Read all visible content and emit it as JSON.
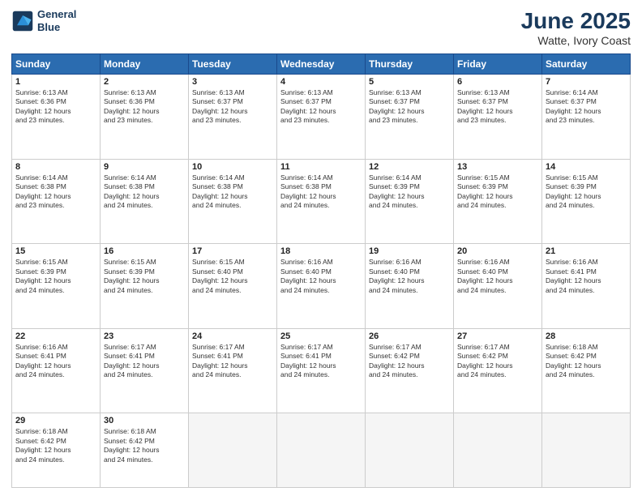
{
  "logo": {
    "line1": "General",
    "line2": "Blue"
  },
  "title": "June 2025",
  "subtitle": "Watte, Ivory Coast",
  "days_of_week": [
    "Sunday",
    "Monday",
    "Tuesday",
    "Wednesday",
    "Thursday",
    "Friday",
    "Saturday"
  ],
  "weeks": [
    [
      {
        "day": "1",
        "info": "Sunrise: 6:13 AM\nSunset: 6:36 PM\nDaylight: 12 hours\nand 23 minutes."
      },
      {
        "day": "2",
        "info": "Sunrise: 6:13 AM\nSunset: 6:36 PM\nDaylight: 12 hours\nand 23 minutes."
      },
      {
        "day": "3",
        "info": "Sunrise: 6:13 AM\nSunset: 6:37 PM\nDaylight: 12 hours\nand 23 minutes."
      },
      {
        "day": "4",
        "info": "Sunrise: 6:13 AM\nSunset: 6:37 PM\nDaylight: 12 hours\nand 23 minutes."
      },
      {
        "day": "5",
        "info": "Sunrise: 6:13 AM\nSunset: 6:37 PM\nDaylight: 12 hours\nand 23 minutes."
      },
      {
        "day": "6",
        "info": "Sunrise: 6:13 AM\nSunset: 6:37 PM\nDaylight: 12 hours\nand 23 minutes."
      },
      {
        "day": "7",
        "info": "Sunrise: 6:14 AM\nSunset: 6:37 PM\nDaylight: 12 hours\nand 23 minutes."
      }
    ],
    [
      {
        "day": "8",
        "info": "Sunrise: 6:14 AM\nSunset: 6:38 PM\nDaylight: 12 hours\nand 23 minutes."
      },
      {
        "day": "9",
        "info": "Sunrise: 6:14 AM\nSunset: 6:38 PM\nDaylight: 12 hours\nand 24 minutes."
      },
      {
        "day": "10",
        "info": "Sunrise: 6:14 AM\nSunset: 6:38 PM\nDaylight: 12 hours\nand 24 minutes."
      },
      {
        "day": "11",
        "info": "Sunrise: 6:14 AM\nSunset: 6:38 PM\nDaylight: 12 hours\nand 24 minutes."
      },
      {
        "day": "12",
        "info": "Sunrise: 6:14 AM\nSunset: 6:39 PM\nDaylight: 12 hours\nand 24 minutes."
      },
      {
        "day": "13",
        "info": "Sunrise: 6:15 AM\nSunset: 6:39 PM\nDaylight: 12 hours\nand 24 minutes."
      },
      {
        "day": "14",
        "info": "Sunrise: 6:15 AM\nSunset: 6:39 PM\nDaylight: 12 hours\nand 24 minutes."
      }
    ],
    [
      {
        "day": "15",
        "info": "Sunrise: 6:15 AM\nSunset: 6:39 PM\nDaylight: 12 hours\nand 24 minutes."
      },
      {
        "day": "16",
        "info": "Sunrise: 6:15 AM\nSunset: 6:39 PM\nDaylight: 12 hours\nand 24 minutes."
      },
      {
        "day": "17",
        "info": "Sunrise: 6:15 AM\nSunset: 6:40 PM\nDaylight: 12 hours\nand 24 minutes."
      },
      {
        "day": "18",
        "info": "Sunrise: 6:16 AM\nSunset: 6:40 PM\nDaylight: 12 hours\nand 24 minutes."
      },
      {
        "day": "19",
        "info": "Sunrise: 6:16 AM\nSunset: 6:40 PM\nDaylight: 12 hours\nand 24 minutes."
      },
      {
        "day": "20",
        "info": "Sunrise: 6:16 AM\nSunset: 6:40 PM\nDaylight: 12 hours\nand 24 minutes."
      },
      {
        "day": "21",
        "info": "Sunrise: 6:16 AM\nSunset: 6:41 PM\nDaylight: 12 hours\nand 24 minutes."
      }
    ],
    [
      {
        "day": "22",
        "info": "Sunrise: 6:16 AM\nSunset: 6:41 PM\nDaylight: 12 hours\nand 24 minutes."
      },
      {
        "day": "23",
        "info": "Sunrise: 6:17 AM\nSunset: 6:41 PM\nDaylight: 12 hours\nand 24 minutes."
      },
      {
        "day": "24",
        "info": "Sunrise: 6:17 AM\nSunset: 6:41 PM\nDaylight: 12 hours\nand 24 minutes."
      },
      {
        "day": "25",
        "info": "Sunrise: 6:17 AM\nSunset: 6:41 PM\nDaylight: 12 hours\nand 24 minutes."
      },
      {
        "day": "26",
        "info": "Sunrise: 6:17 AM\nSunset: 6:42 PM\nDaylight: 12 hours\nand 24 minutes."
      },
      {
        "day": "27",
        "info": "Sunrise: 6:17 AM\nSunset: 6:42 PM\nDaylight: 12 hours\nand 24 minutes."
      },
      {
        "day": "28",
        "info": "Sunrise: 6:18 AM\nSunset: 6:42 PM\nDaylight: 12 hours\nand 24 minutes."
      }
    ],
    [
      {
        "day": "29",
        "info": "Sunrise: 6:18 AM\nSunset: 6:42 PM\nDaylight: 12 hours\nand 24 minutes."
      },
      {
        "day": "30",
        "info": "Sunrise: 6:18 AM\nSunset: 6:42 PM\nDaylight: 12 hours\nand 24 minutes."
      },
      null,
      null,
      null,
      null,
      null
    ]
  ]
}
